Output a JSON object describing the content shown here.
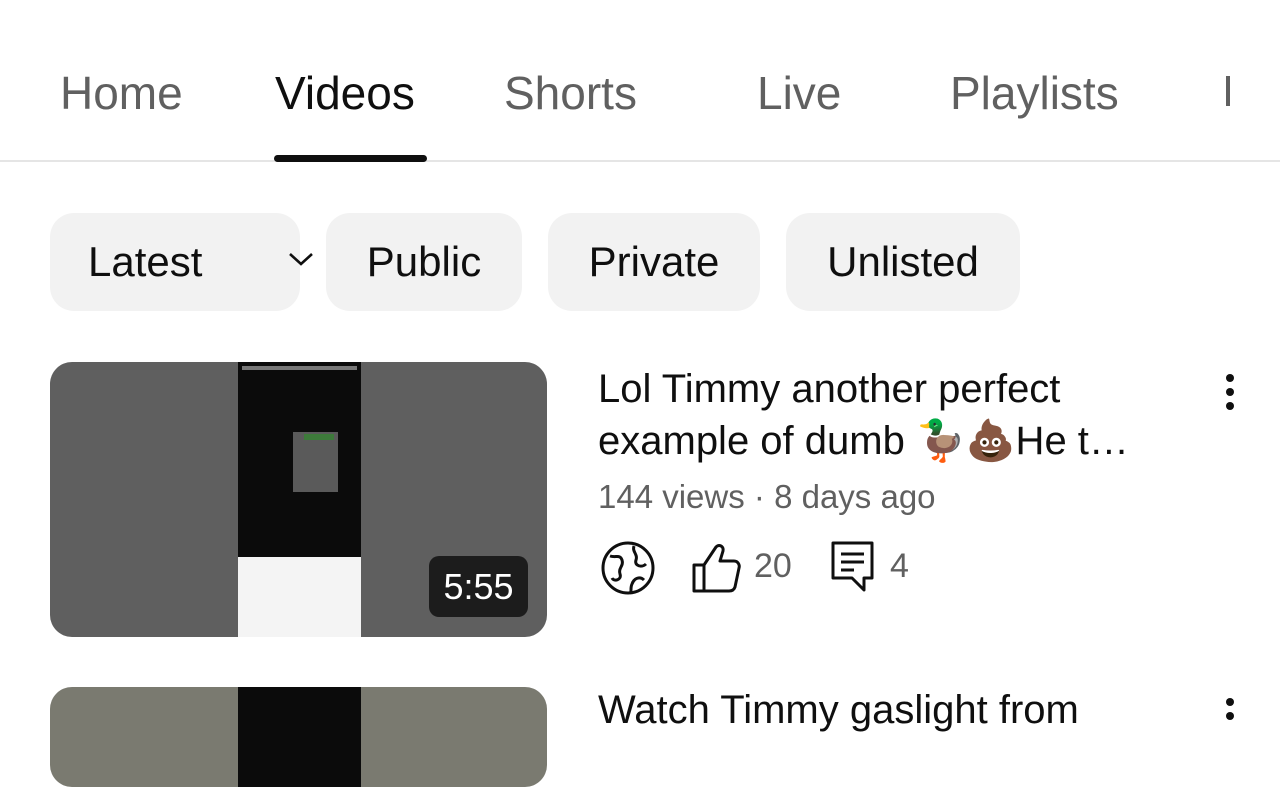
{
  "tabs": {
    "home": "Home",
    "videos": "Videos",
    "shorts": "Shorts",
    "live": "Live",
    "playlists": "Playlists",
    "active": "Videos"
  },
  "filters": {
    "sort": "Latest",
    "public": "Public",
    "private": "Private",
    "unlisted": "Unlisted"
  },
  "videos": [
    {
      "title_line1": "Lol Timmy another perfect",
      "title_line2": "example of dumb 🦆💩He t…",
      "duration": "5:55",
      "meta": "144 views · 8 days ago",
      "visibility_icon": "globe-icon",
      "likes": "20",
      "comments": "4"
    },
    {
      "title_line1": "Watch Timmy gaslight from"
    }
  ],
  "colors": {
    "text_primary": "#0f0f0f",
    "text_secondary": "#606060",
    "chip_bg": "#f2f2f2",
    "duration_bg": "#1c1c1c"
  }
}
